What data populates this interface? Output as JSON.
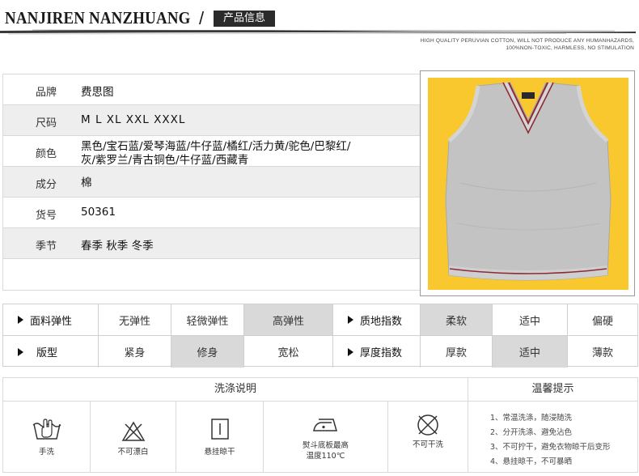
{
  "header": {
    "brand": "NANJIREN NANZHUANG",
    "slash": "/",
    "section_title": "产品信息",
    "tagline_line1": "HIGH QUALITY PERUVIAN COTTON, WILL NOT PRODUCE ANY HUMANHAZARDS,",
    "tagline_line2": "100%NON-TOXIC, HARMLESS, NO STIMULATION"
  },
  "specs": {
    "brand_label": "品牌",
    "brand_value": "费思图",
    "size_label": "尺码",
    "size_value": "M  L  XL  XXL  XXXL",
    "color_label": "颜色",
    "color_value_line1": "黑色/宝石蓝/爱琴海蓝/牛仔蓝/橘红/活力黄/驼色/巴黎红/",
    "color_value_line2": "灰/紫罗兰/青古铜色/牛仔蓝/西藏青",
    "material_label": "成分",
    "material_value": "棉",
    "item_no_label": "货号",
    "item_no_value": "50361",
    "season_label": "季节",
    "season_value": "春季  秋季  冬季"
  },
  "attributes": {
    "elasticity_label": "面料弹性",
    "elasticity_options": [
      "无弹性",
      "轻微弹性",
      "高弹性"
    ],
    "elasticity_selected": "高弹性",
    "texture_label": "质地指数",
    "texture_options": [
      "柔软",
      "适中",
      "偏硬"
    ],
    "texture_selected": "柔软",
    "fit_label": "版型",
    "fit_options": [
      "紧身",
      "修身",
      "宽松"
    ],
    "fit_selected": "修身",
    "thickness_label": "厚度指数",
    "thickness_options": [
      "厚款",
      "适中",
      "薄款"
    ],
    "thickness_selected": "适中"
  },
  "wash": {
    "title": "洗涤说明",
    "hand_wash": "手洗",
    "no_bleach": "不可漂白",
    "hang_dry": "悬挂晾干",
    "iron_line1": "熨斗底板最高",
    "iron_line2": "温度110℃",
    "no_dry_clean": "不可干洗"
  },
  "tips": {
    "title": "温馨提示",
    "items": [
      "1、常温洗涤，随浸随洗",
      "2、分开洗涤、避免沾色",
      "3、不可拧干，避免衣物晾干后变形",
      "4、悬挂晾干，不可暴晒"
    ]
  },
  "colors": {
    "photo_background": "#f9c72e",
    "garment": "#c3c3c3",
    "trim": "#8e2a35",
    "highlight_cell": "#d9d9d9",
    "title_box": "#2b2b2b"
  }
}
